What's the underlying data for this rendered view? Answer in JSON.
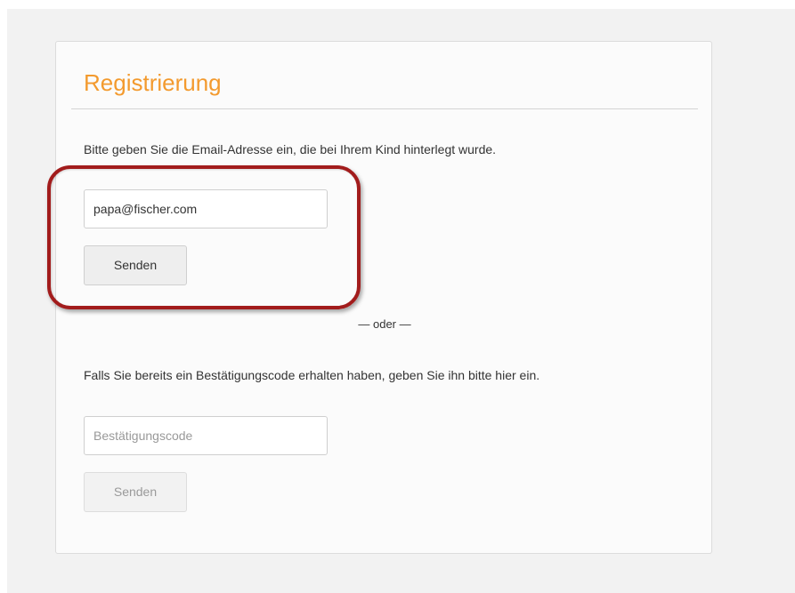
{
  "header": {
    "title": "Registrierung"
  },
  "email_section": {
    "instruction": "Bitte geben Sie die Email-Adresse ein, die bei Ihrem Kind hinterlegt wurde.",
    "email_value": "papa@fischer.com",
    "send_label": "Senden"
  },
  "separator": {
    "label": "— oder —"
  },
  "code_section": {
    "instruction": "Falls Sie bereits ein Bestätigungscode erhalten haben, geben Sie ihn bitte hier ein.",
    "code_placeholder": "Bestätigungscode",
    "code_value": "",
    "send_label": "Senden",
    "send_disabled": true
  },
  "colors": {
    "title_accent": "#f39a2e",
    "highlight_outline": "#a21c1c",
    "card_background": "#fbfbfb",
    "page_background": "#f2f2f2"
  }
}
